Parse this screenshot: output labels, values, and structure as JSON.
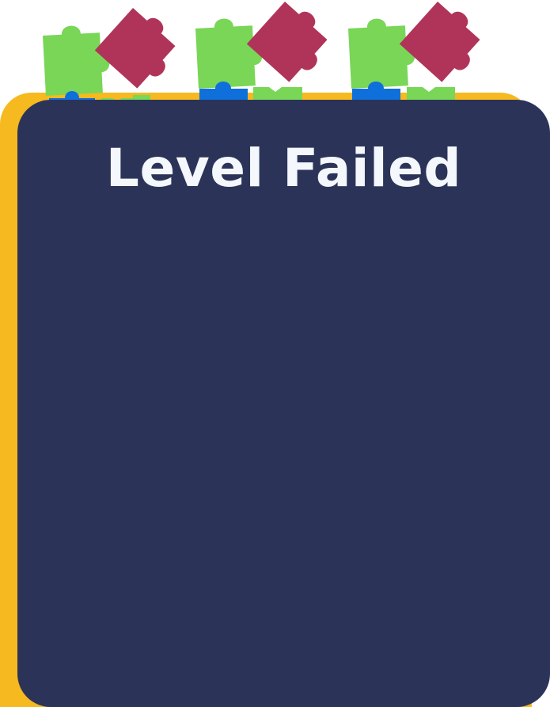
{
  "dialog": {
    "title": "Level Failed"
  },
  "colors": {
    "panel": "#2b3458",
    "panel_back": "#f6b91f",
    "title_text": "#f4f7fb",
    "piece_green": "#79d657",
    "piece_crimson": "#b03459",
    "piece_blue": "#0f6fdb"
  },
  "decorations": {
    "icon": "puzzle-piece-icon",
    "count": 3
  }
}
